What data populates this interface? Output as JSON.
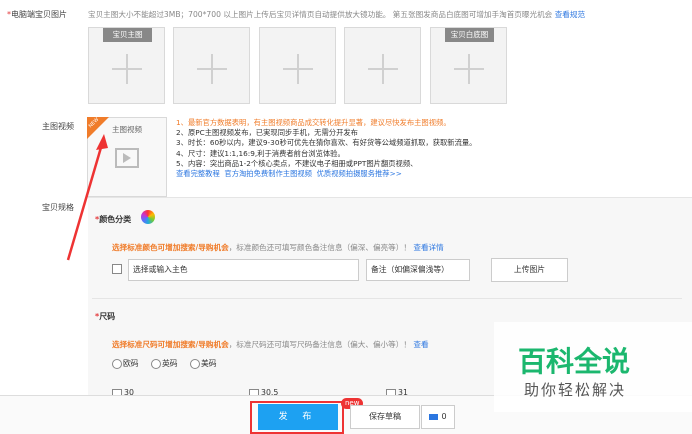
{
  "main_image": {
    "label_required": "*",
    "label": "电脑端宝贝图片",
    "hint": "宝贝主图大小不能超过3MB；700*700 以上图片上传后宝贝详情页自动提供放大镜功能。 第五张图发商品白底图可增加手淘首页曝光机会",
    "hint_link": "查看规范",
    "slot_first_caption": "宝贝主图",
    "slot_last_caption": "宝贝白底图"
  },
  "video": {
    "label": "主图视频",
    "thumb_caption": "主图视频",
    "ribbon": "NEW",
    "lines": [
      "1、最新官方数据表明，有主图视频商品成交转化提升显著，建议尽快发布主图视频。",
      "2、原PC主图视频发布，已実现同步手机，无需分开发布",
      "3、时长：60秒以内，建议9-30秒可优先在猜你喜欢、有好货等公域频道抓取，获取新流量。",
      "4、尺寸：建议1:1,16:9,利于消费者前台浏览体验。",
      "5、内容：突出商品1-2个核心卖点，不建议电子相册或PPT图片翻页视频、"
    ],
    "links": [
      "查看完整教程",
      "官方淘拍免费制作主图视频",
      "优质视频拍摄服务推荐>>"
    ]
  },
  "spec": {
    "label": "宝贝规格",
    "color": {
      "required": "*",
      "title": "颜色分类",
      "warn_strong": "选择标准颜色可增加搜索/导购机会",
      "warn_rest": "，标准颜色还可填写颜色备注信息（偏深、偏亮等）！",
      "warn_link": "查看详情",
      "main_color_value": "选择或输入主色",
      "remark_value": "备注（如偏深偏浅等）",
      "upload_label": "上传图片"
    },
    "size": {
      "required": "*",
      "title": "尺码",
      "warn_strong": "选择标准尺码可增加搜索/导购机会",
      "warn_rest": "，标准尺码还可填写尺码备注信息（偏大、偏小等）！",
      "warn_link": "查看",
      "radios": [
        "欧码",
        "英码",
        "美码"
      ],
      "options": [
        "30",
        "30.5",
        "31"
      ]
    }
  },
  "footer": {
    "publish_label": "发 布",
    "new_badge": "new",
    "draft_label": "保存草稿",
    "message_count": "0"
  },
  "watermark": {
    "line1": "百科全说",
    "line2": "助你轻松解决",
    "color": "#1bb76e"
  },
  "colors": {
    "accent_blue": "#1da1f2",
    "link_blue": "#2b76e0",
    "orange": "#f07c2a",
    "red": "#e33333"
  }
}
